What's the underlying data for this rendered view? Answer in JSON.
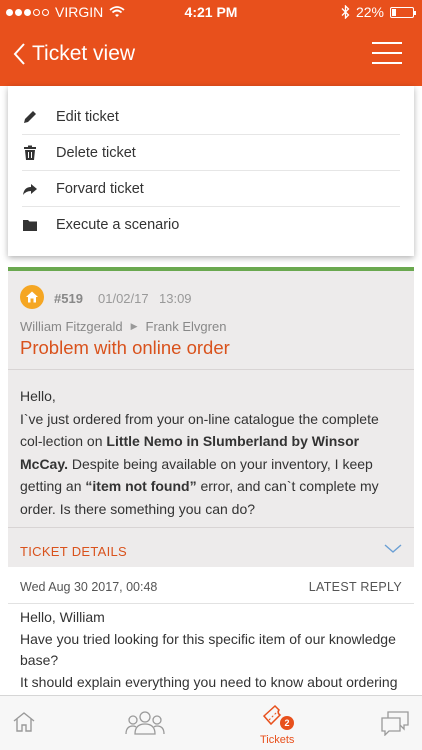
{
  "status_bar": {
    "carrier": "VIRGIN",
    "time": "4:21 PM",
    "battery_text": "22%",
    "battery_level": 0.22
  },
  "header": {
    "title": "Ticket view",
    "back_icon": "chevron-left-icon",
    "menu_icon": "hamburger-menu-icon"
  },
  "menu": {
    "items": [
      {
        "label": "Edit ticket",
        "icon": "pencil-icon"
      },
      {
        "label": "Delete ticket",
        "icon": "trash-icon"
      },
      {
        "label": "Forvard ticket",
        "icon": "forward-arrow-icon"
      },
      {
        "label": "Execute a scenario",
        "icon": "folder-icon"
      }
    ]
  },
  "ticket": {
    "status_color": "#6aa84f",
    "id": "#519",
    "date": "01/02/17",
    "time": "13:09",
    "from": "William Fitzgerald",
    "to": "Frank Elvgren",
    "subject": "Problem with online order",
    "message": {
      "greeting": "Hello,",
      "p1": "I`ve just ordered from your on-line catalogue the complete col-lection on ",
      "bold1": "Little Nemo in Slumberland by Winsor McCay.",
      "p2": " Despite being available on your inventory, I keep getting an ",
      "bold2": "“item not found”",
      "p3": " error, and can`t complete my order. Is there something you can do?"
    },
    "details_label": "TICKET DETAILS"
  },
  "reply": {
    "date": "Wed Aug 30 2017, 00:48",
    "tag": "LATEST REPLY",
    "lines": [
      "Hello, William",
      "Have you tried looking for this specific item of our knowledge base?",
      "It should explain everything you need to know about ordering"
    ]
  },
  "tabs": {
    "home_icon": "home-icon",
    "users_icon": "users-icon",
    "tickets_label": "Tickets",
    "tickets_badge": "2",
    "tickets_icon": "tickets-icon",
    "chat_icon": "chat-bubbles-icon"
  },
  "colors": {
    "brand": "#e8501c",
    "accent_text": "#d9521c",
    "ticket_bg": "#edebeb"
  }
}
